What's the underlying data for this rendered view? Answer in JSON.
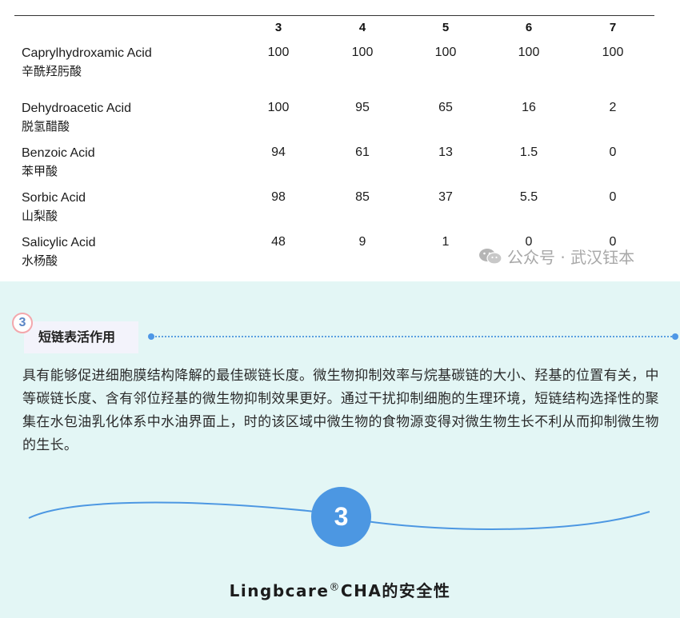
{
  "table": {
    "columns": [
      "3",
      "4",
      "5",
      "6",
      "7"
    ],
    "rows": [
      {
        "name": "Caprylhydroxamic Acid",
        "cn": "辛酰羟肟酸",
        "values": [
          "100",
          "100",
          "100",
          "100",
          "100"
        ]
      },
      {
        "name": "Dehydroacetic Acid",
        "cn": "脱氢醋酸",
        "values": [
          "100",
          "95",
          "65",
          "16",
          "2"
        ]
      },
      {
        "name": "Benzoic Acid",
        "cn": "苯甲酸",
        "values": [
          "94",
          "61",
          "13",
          "1.5",
          "0"
        ]
      },
      {
        "name": "Sorbic Acid",
        "cn": "山梨酸",
        "values": [
          "98",
          "85",
          "37",
          "5.5",
          "0"
        ]
      },
      {
        "name": "Salicylic Acid",
        "cn": "水杨酸",
        "values": [
          "48",
          "9",
          "1",
          "0",
          "0"
        ]
      }
    ]
  },
  "watermark": {
    "text": "公众号 · 武汉钰本",
    "icon": "wechat-icon"
  },
  "section": {
    "number": "3",
    "label": "短链表活作用",
    "paragraph": "具有能够促进细胞膜结构降解的最佳碳链长度。微生物抑制效率与烷基碳链的大小、羟基的位置有关，中等碳链长度、含有邻位羟基的微生物抑制效果更好。通过干扰抑制细胞的生理环境，短链结构选择性的聚集在水包油乳化体系中水油界面上，时的该区域中微生物的食物源变得对微生物生长不利从而抑制微生物的生长。"
  },
  "divider": {
    "number": "3"
  },
  "footer": {
    "title_prefix": "Lingbcare",
    "registered": "®",
    "title_suffix": "CHA的安全性"
  },
  "colors": {
    "panel": "#e3f6f5",
    "accent": "#4c97e2",
    "pink": "#f3a7ac"
  }
}
